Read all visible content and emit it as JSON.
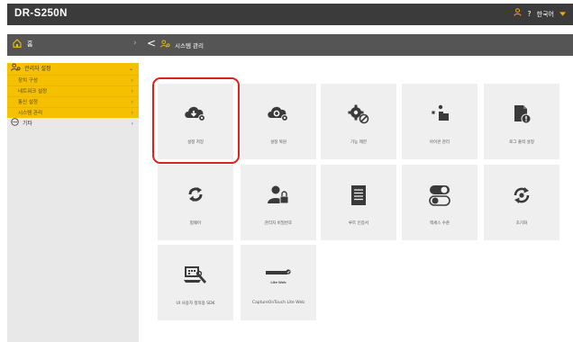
{
  "header": {
    "title": "DR-S250N",
    "help": "?",
    "language": "한국어"
  },
  "nav": {
    "home_label": "홈",
    "separator": "›",
    "back": "<",
    "crumb_label": "시스템 관리"
  },
  "sidebar": {
    "items": [
      {
        "label": "관리자 설정",
        "type": "top",
        "chev": "⌄",
        "selected": true
      },
      {
        "label": "장치 구성",
        "type": "sub",
        "chev": "›"
      },
      {
        "label": "네트워크 설정",
        "type": "sub",
        "chev": "›"
      },
      {
        "label": "통신 설정",
        "type": "sub",
        "chev": "›"
      },
      {
        "label": "시스템 관리",
        "type": "sub",
        "chev": "›"
      },
      {
        "label": "기타",
        "type": "top-plain",
        "chev": "›"
      }
    ]
  },
  "tiles": [
    {
      "label": "설정 저장",
      "icon": "cloud-download-gear-icon"
    },
    {
      "label": "설정 복원",
      "icon": "cloud-upload-gear-icon"
    },
    {
      "label": "기능 제한",
      "icon": "gears-block-icon"
    },
    {
      "label": "아이콘 관리",
      "icon": "icon-management-icon"
    },
    {
      "label": "로그 출력 설정",
      "icon": "log-output-icon"
    },
    {
      "label": "펌웨어",
      "icon": "refresh-icon"
    },
    {
      "label": "관리자 비밀번호",
      "icon": "user-lock-icon"
    },
    {
      "label": "루트 인증서",
      "icon": "document-icon"
    },
    {
      "label": "액세스 수준",
      "icon": "toggle-icon"
    },
    {
      "label": "초기화",
      "icon": "reset-gear-icon"
    },
    {
      "label": "UI 사용자 정의용 SDK",
      "icon": "sdk-computer-icon"
    },
    {
      "label": "CaptureOnTouch Lite Web",
      "icon": "captureontouch-logo-icon",
      "logo_text": "Lite Web"
    }
  ],
  "colors": {
    "accent": "#f5c000",
    "header_bg": "#3b3b3b",
    "nav_bg": "#555555",
    "sidebar_bg": "#e8e8e8",
    "tile_bg": "#efefef",
    "highlight": "#e0201c"
  }
}
